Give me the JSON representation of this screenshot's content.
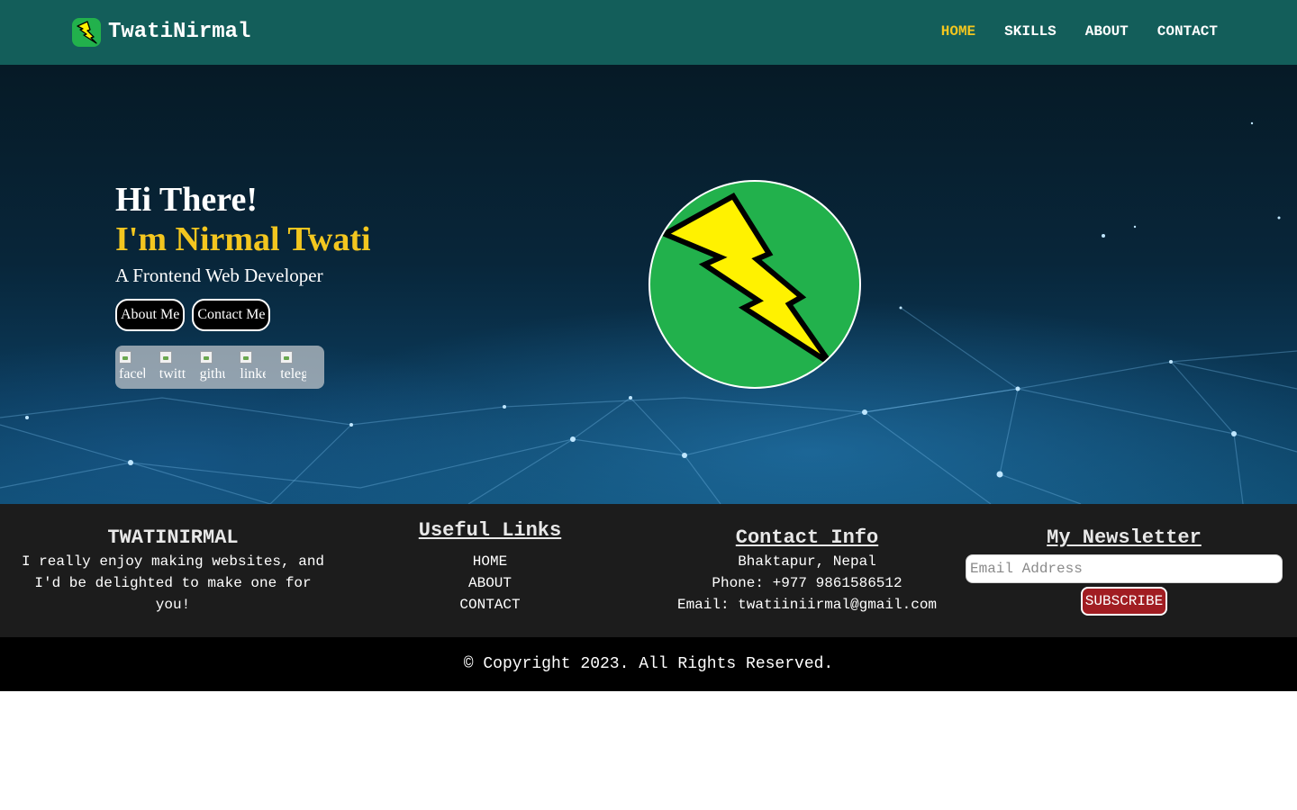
{
  "brand": {
    "name": "TwatiNirmal",
    "logo_icon": "lightning-icon"
  },
  "nav": {
    "items": [
      {
        "label": "HOME",
        "active": true
      },
      {
        "label": "SKILLS",
        "active": false
      },
      {
        "label": "ABOUT",
        "active": false
      },
      {
        "label": "CONTACT",
        "active": false
      }
    ]
  },
  "hero": {
    "greeting": "Hi There!",
    "name": "I'm Nirmal Twati",
    "role": "A Frontend Web Developer",
    "buttons": {
      "about": "About Me",
      "contact": "Contact Me"
    },
    "socials": [
      {
        "alt": "facebook",
        "visible_text": "faceb"
      },
      {
        "alt": "twitter",
        "visible_text": "twitte"
      },
      {
        "alt": "github",
        "visible_text": "githu"
      },
      {
        "alt": "linkedin",
        "visible_text": "linke"
      },
      {
        "alt": "telegram",
        "visible_text": "teleg"
      }
    ],
    "avatar_icon": "lightning-bolt-icon"
  },
  "footer": {
    "about": {
      "title": "TWATINIRMAL",
      "text": "I really enjoy making websites, and I'd be delighted to make one for you!"
    },
    "links": {
      "title": "Useful Links",
      "items": [
        "HOME",
        "ABOUT",
        "CONTACT"
      ]
    },
    "contact": {
      "title": "Contact Info",
      "address": "Bhaktapur, Nepal",
      "phone": "Phone: +977 9861586512",
      "email": "Email: twatiiniirmal@gmail.com"
    },
    "newsletter": {
      "title": "My Newsletter",
      "placeholder": "Email Address",
      "button": "SUBSCRIBE"
    }
  },
  "copyright": "© Copyright 2023. All Rights Reserved.",
  "colors": {
    "navbar": "#135e5a",
    "accent": "#f3c61f",
    "logo_green": "#22b14c",
    "bolt_yellow": "#fff200",
    "footer": "#1c1c1c",
    "subscribe": "#a11d22"
  }
}
